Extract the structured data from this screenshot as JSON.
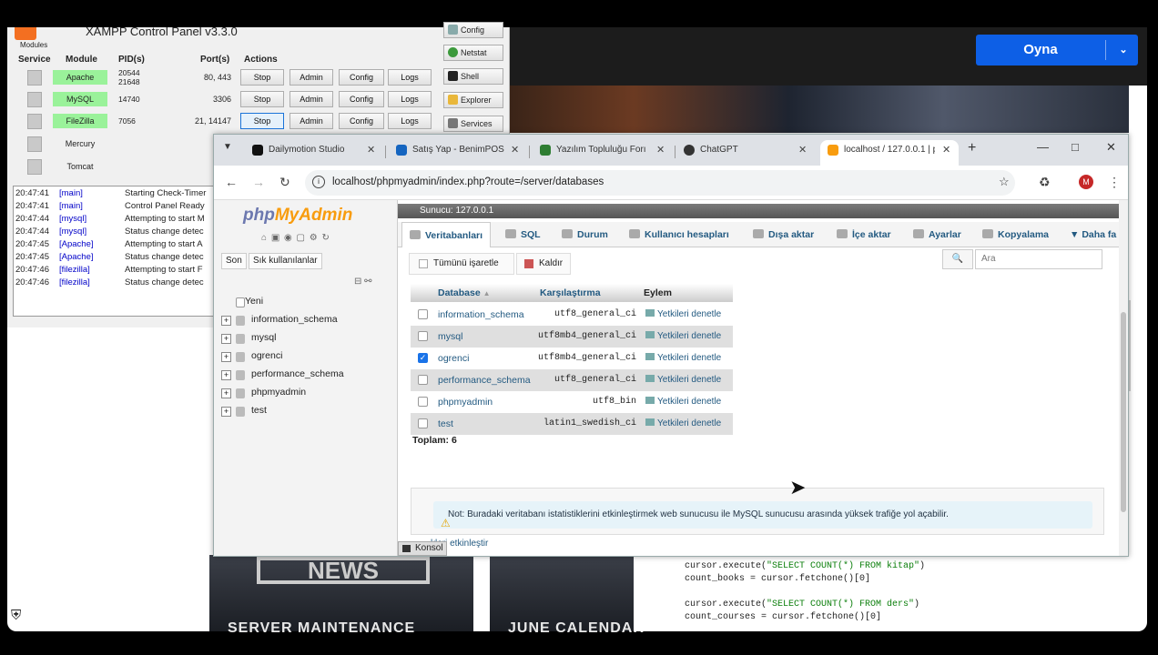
{
  "overlay_button": {
    "label": "Oyna"
  },
  "background_news": {
    "big": "NEWS",
    "caption_left": "SERVER MAINTENANCE",
    "caption_right": "JUNE CALENDAR"
  },
  "code_snippet": {
    "line1_a": "cursor.execute(",
    "line1_s": "\"SELECT COUNT(*) FROM kitap\"",
    "line1_b": ")",
    "line2": "count_books = cursor.fetchone()[0]",
    "line3_a": "cursor.execute(",
    "line3_s": "\"SELECT COUNT(*) FROM ders\"",
    "line3_b": ")",
    "line4": "count_courses = cursor.fetchone()[0]"
  },
  "xampp": {
    "title": "XAMPP Control Panel v3.3.0",
    "modules_label": "Modules",
    "headers": {
      "service": "Service",
      "module": "Module",
      "pid": "PID(s)",
      "ports": "Port(s)",
      "actions": "Actions"
    },
    "rows": [
      {
        "module": "Apache",
        "pid": "20544\n21648",
        "ports": "80, 443",
        "stop": "Stop",
        "admin": "Admin",
        "config": "Config",
        "logs": "Logs"
      },
      {
        "module": "MySQL",
        "pid": "14740",
        "ports": "3306",
        "stop": "Stop",
        "admin": "Admin",
        "config": "Config",
        "logs": "Logs"
      },
      {
        "module": "FileZilla",
        "pid": "7056",
        "ports": "21, 14147",
        "stop": "Stop",
        "admin": "Admin",
        "config": "Config",
        "logs": "Logs"
      },
      {
        "module": "Mercury"
      },
      {
        "module": "Tomcat"
      }
    ],
    "side_buttons": [
      "Config",
      "Netstat",
      "Shell",
      "Explorer",
      "Services"
    ],
    "log": [
      {
        "time": "20:47:41",
        "mod": "[main]",
        "msg": "Starting Check-Timer"
      },
      {
        "time": "20:47:41",
        "mod": "[main]",
        "msg": "Control Panel Ready"
      },
      {
        "time": "20:47:44",
        "mod": "[mysql]",
        "msg": "Attempting to start M"
      },
      {
        "time": "20:47:44",
        "mod": "[mysql]",
        "msg": "Status change detec"
      },
      {
        "time": "20:47:45",
        "mod": "[Apache]",
        "msg": "Attempting to start A"
      },
      {
        "time": "20:47:45",
        "mod": "[Apache]",
        "msg": "Status change detec"
      },
      {
        "time": "20:47:46",
        "mod": "[filezilla]",
        "msg": "Attempting to start F"
      },
      {
        "time": "20:47:46",
        "mod": "[filezilla]",
        "msg": "Status change detec"
      }
    ]
  },
  "browser": {
    "tabs": [
      {
        "title": "Dailymotion Studio",
        "color": "#111111"
      },
      {
        "title": "Satış Yap - BenimPOS",
        "color": "#1565c0"
      },
      {
        "title": "Yazılım Topluluğu Forı",
        "color": "#2e7d32"
      },
      {
        "title": "ChatGPT",
        "color": "#333333"
      },
      {
        "title": "localhost / 127.0.0.1 | p",
        "color": "#f89c0e"
      }
    ],
    "url": "localhost/phpmyadmin/index.php?route=/server/databases",
    "avatar_letter": "M"
  },
  "pma": {
    "logo_a": "php",
    "logo_b": "MyAdmin",
    "left_tabs": [
      "Son",
      "Sık kullanılanlar"
    ],
    "tree": [
      "Yeni",
      "information_schema",
      "mysql",
      "ogrenci",
      "performance_schema",
      "phpmyadmin",
      "test"
    ],
    "server_bar": "Sunucu: 127.0.0.1",
    "menu": [
      "Veritabanları",
      "SQL",
      "Durum",
      "Kullanıcı hesapları",
      "Dışa aktar",
      "İçe aktar",
      "Ayarlar",
      "Kopyalama",
      "Daha fa"
    ],
    "check_all": "Tümünü işaretle",
    "drop": "Kaldır",
    "search_placeholder": "Ara",
    "columns": {
      "database": "Database",
      "collation": "Karşılaştırma",
      "action": "Eylem"
    },
    "databases": [
      {
        "name": "information_schema",
        "collation": "utf8_general_ci",
        "action": "Yetkileri denetle",
        "checked": false
      },
      {
        "name": "mysql",
        "collation": "utf8mb4_general_ci",
        "action": "Yetkileri denetle",
        "checked": false
      },
      {
        "name": "ogrenci",
        "collation": "utf8mb4_general_ci",
        "action": "Yetkileri denetle",
        "checked": true
      },
      {
        "name": "performance_schema",
        "collation": "utf8_general_ci",
        "action": "Yetkileri denetle",
        "checked": false
      },
      {
        "name": "phpmyadmin",
        "collation": "utf8_bin",
        "action": "Yetkileri denetle",
        "checked": false
      },
      {
        "name": "test",
        "collation": "latin1_swedish_ci",
        "action": "Yetkileri denetle",
        "checked": false
      }
    ],
    "total": "Toplam: 6",
    "notice": "Not: Buradaki veritabanı istatistiklerini etkinleştirmek web sunucusu ile MySQL sunucusu arasında yüksek trafiğe yol açabilir.",
    "enable_link": "kleri etkinleştir",
    "console": "Konsol"
  }
}
